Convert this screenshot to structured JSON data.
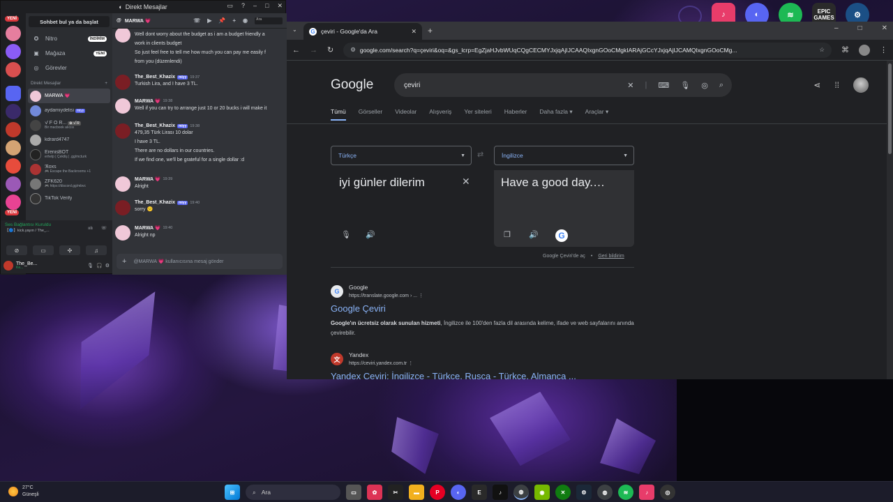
{
  "discord": {
    "title": "Direkt Mesajlar",
    "search_button": "Sohbet bul ya da başlat",
    "rail_badges": [
      "YENİ",
      "YENİ"
    ],
    "nav": [
      {
        "label": "Nitro",
        "pill": "İNDİRİM",
        "icon": "nitro-icon"
      },
      {
        "label": "Mağaza",
        "pill": "YENİ",
        "icon": "shop-icon"
      },
      {
        "label": "Görevler",
        "pill": "",
        "icon": "quests-icon"
      }
    ],
    "dm_header": "Direkt Mesajlar",
    "dm_add": "+",
    "dms": [
      {
        "name": "MARWA 💗",
        "sub": "",
        "color": "#f0c8d8"
      },
      {
        "name": "aydamiydelisi",
        "sub": "",
        "tag": "miyy",
        "color": "#7289da"
      },
      {
        "name": "ꪜ F O R...",
        "sub": "Bir macbook alıcısı",
        "tag": "✿·ꪜ·R",
        "color": "#444"
      },
      {
        "name": "kdrard4747",
        "sub": "",
        "color": "#aaa"
      },
      {
        "name": "ErenisBOT",
        "sub": "erhelp | Çekiliş | .gg/mcturk",
        "color": "#222"
      },
      {
        "name": "ℜoxs",
        "sub": "🎮 Escape the Backrooms +1",
        "color": "#a33"
      },
      {
        "name": "ZFK620",
        "sub": "🎮 https://discord.gg/mbvc",
        "color": "#777"
      },
      {
        "name": "TikTok Verify",
        "sub": "",
        "color": "#333"
      }
    ],
    "voice_status": "Ses Bağlantısı Kuruldu",
    "voice_channel": "【🔵】kick.yayın / The_...",
    "user_name": "The_Be...",
    "user_status": "Ke...",
    "chat_header_name": "MARWA 💗",
    "chat_search": "Ara",
    "messages": [
      {
        "author": "",
        "time": "",
        "tag": "",
        "lines": [
          "Well dont worry about the budget as i am a budget friendly a",
          "work in clients budget",
          "So just feel free to tell me how much you can pay me easily f",
          "from you (düzenlendi)"
        ]
      },
      {
        "author": "The_Best_Khazix",
        "time": "19:37",
        "tag": "miyy",
        "lines": [
          "Turkish Lira, and I have 3 TL."
        ]
      },
      {
        "author": "MARWA 💗",
        "time": "19:38",
        "tag": "",
        "lines": [
          "Well if you can try to arrange just 10 or 20 bucks i will make it"
        ]
      },
      {
        "author": "The_Best_Khazix",
        "time": "19:38",
        "tag": "miyy",
        "lines": [
          "479,35 Türk Lirası 10 dolar",
          "I have 3 TL.",
          "There are no dollars in our countries.",
          "If we find one, we'll be grateful for a single dollar :d"
        ]
      },
      {
        "author": "MARWA 💗",
        "time": "19:39",
        "tag": "",
        "lines": [
          "Alright"
        ]
      },
      {
        "author": "The_Best_Khazix",
        "time": "19:40",
        "tag": "miyy",
        "lines": [
          "sorry 😕"
        ]
      },
      {
        "author": "MARWA 💗",
        "time": "19:40",
        "tag": "",
        "lines": [
          "Alright np"
        ]
      }
    ],
    "input_placeholder": "@MARWA 💗 kullanıcısına mesaj gönder"
  },
  "chrome": {
    "tab_title": "çeviri - Google'da Ara",
    "url": "google.com/search?q=çeviri&oq=&gs_lcrp=EgZjaHJvbWUqCQgCECMYJxjqAjIJCAAQIxgnGOoCMgkIARAjGCcYJxjqAjIJCAMQIxgnGOoCMg..."
  },
  "google": {
    "logo": "Google",
    "query": "çeviri",
    "tabs": [
      "Tümü",
      "Görseller",
      "Videolar",
      "Alışveriş",
      "Yer siteleri",
      "Haberler",
      "Daha fazla",
      "Araçlar"
    ],
    "source_lang": "Türkçe",
    "target_lang": "İngilizce",
    "source_text": "iyi günler dilerim",
    "target_text": "Have a good day.",
    "open_translate": "Google Çeviri'de aç",
    "feedback": "Geri bildirim",
    "results": [
      {
        "site": "Google",
        "url": "https://translate.google.com › ...",
        "title": "Google Çeviri",
        "desc_bold": "Google'ın ücretsiz olarak sunulan hizmeti",
        "desc": ", İngilizce ile 100'den fazla dil arasında kelime, ifade ve web sayfalarını anında çevirebilir."
      },
      {
        "site": "Yandex",
        "url": "https://ceviri.yandex.com.tr",
        "title": "Yandex Çeviri: İngilizce - Türkçe, Rusça - Türkçe, Almanca ...",
        "desc_bold": "",
        "desc": ""
      }
    ]
  },
  "taskbar": {
    "temp": "27°C",
    "weather": "Güneşli",
    "search": "Ara"
  },
  "desktop": {
    "epic_label": "EPIC\nGAMES"
  }
}
